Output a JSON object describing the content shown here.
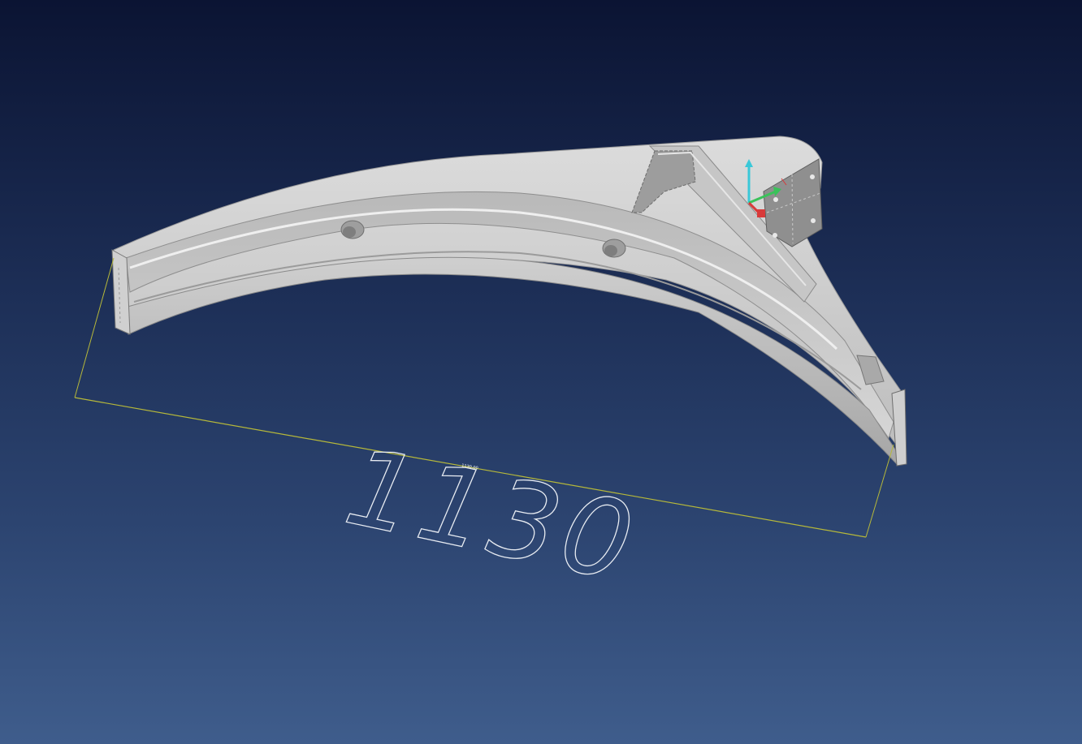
{
  "viewport": {
    "background_top": "#0b1433",
    "background_bottom": "#3f5d8c"
  },
  "model": {
    "body_color": "#bfbfbf",
    "shadow_color": "#8c8c8c",
    "highlight_color": "#e2e2e2"
  },
  "dimension": {
    "value_label": "1130",
    "small_label": "1130.00",
    "line_color": "#b6b83a"
  },
  "triad": {
    "x_axis_color": "#d83a3a",
    "y_axis_color": "#3ac25a",
    "z_axis_color": "#3ac8d8"
  }
}
